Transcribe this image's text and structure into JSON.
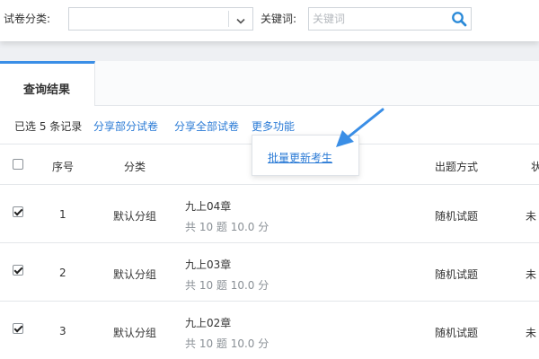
{
  "filters": {
    "category_label": "试卷分类:",
    "category_value": "",
    "keyword_label": "关键词:",
    "keyword_placeholder": "关键词",
    "keyword_value": ""
  },
  "tabs": [
    {
      "label": "查询结果",
      "active": true
    }
  ],
  "toolbar": {
    "selected_text": "已选 5 条记录",
    "share_partial": "分享部分试卷",
    "share_all": "分享全部试卷",
    "more": "更多功能"
  },
  "more_menu": {
    "items": [
      "批量更新考生"
    ]
  },
  "table": {
    "headers": {
      "number": "序号",
      "category": "分类",
      "method": "出题方式",
      "status": "状"
    },
    "rows": [
      {
        "checked": true,
        "no": "1",
        "category": "默认分组",
        "title": "九上04章",
        "summary": "共 10 题 10.0 分",
        "method": "随机试题",
        "status": "未"
      },
      {
        "checked": true,
        "no": "2",
        "category": "默认分组",
        "title": "九上03章",
        "summary": "共 10 题 10.0 分",
        "method": "随机试题",
        "status": "未"
      },
      {
        "checked": true,
        "no": "3",
        "category": "默认分组",
        "title": "九上02章",
        "summary": "共 10 题 10.0 分",
        "method": "随机试题",
        "status": "未"
      }
    ]
  },
  "colors": {
    "accent": "#3a8ee6",
    "link": "#2b7bd6",
    "search_icon": "#2b8ad8"
  },
  "icons": {
    "select_arrow": "chevron-down-icon",
    "search": "search-icon",
    "pointer": "callout-arrow-icon"
  }
}
